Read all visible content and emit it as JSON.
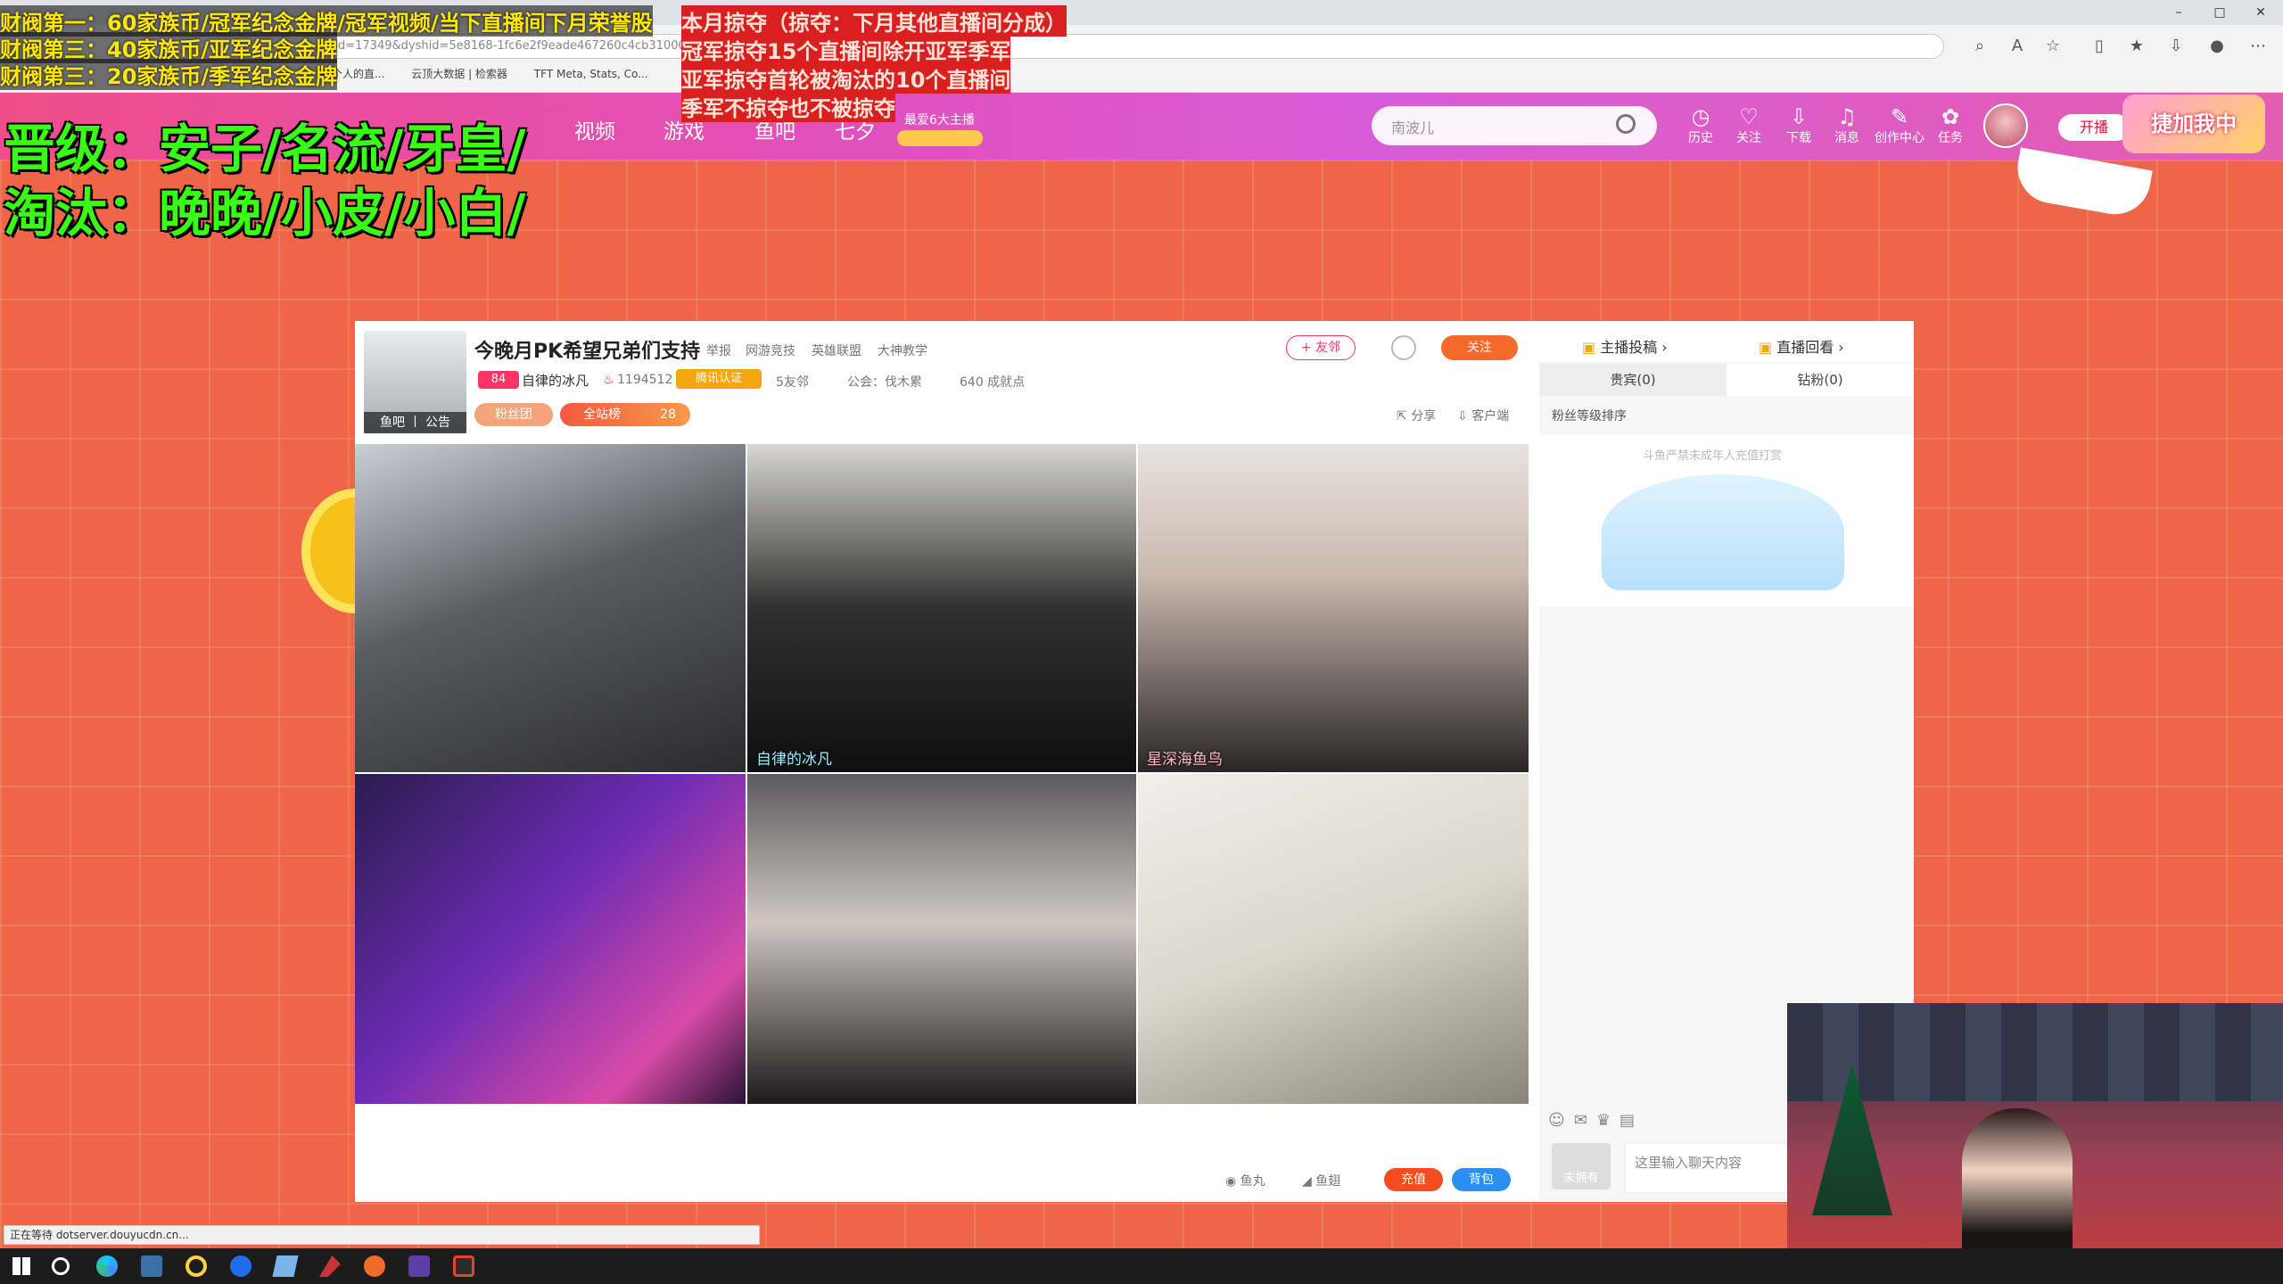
{
  "browser": {
    "url": "d=17349&dyshid=5e8168-1fc6e2f9eade467260c4cb3100021",
    "bookmarks": [
      "每个人的直...",
      "云顶大数据 | 检索器",
      "TFT Meta, Stats, Co..."
    ],
    "status_text": "正在等待 dotserver.douyucdn.cn..."
  },
  "overlay": {
    "yellow_lines": [
      "财阀第一：60家族币/冠军纪念金牌/冠军视频/当下直播间下月荣誉股",
      "财阀第三：40家族币/亚军纪念金牌",
      "财阀第三：20家族币/季军纪念金牌"
    ],
    "red_lines": [
      "本月掠夺（掠夺：下月其他直播间分成）",
      "冠军掠夺15个直播间除开亚军季军",
      "亚军掠夺首轮被淘汰的10个直播间",
      "季军不掠夺也不被掠夺"
    ],
    "promoted": "晋级：安子/名流/牙皇/",
    "eliminated": "淘汰：晚晚/小皮/小白/"
  },
  "site_header": {
    "nav": [
      "视频",
      "游戏",
      "鱼吧",
      "七夕"
    ],
    "promo_label": "最爱6大主播",
    "search_placeholder": "南波儿",
    "icons": [
      {
        "name": "history-icon",
        "glyph": "◷",
        "label": "历史"
      },
      {
        "name": "follow-icon",
        "glyph": "♡",
        "label": "关注"
      },
      {
        "name": "download-icon",
        "glyph": "⇩",
        "label": "下载"
      },
      {
        "name": "message-icon",
        "glyph": "♫",
        "label": "消息"
      },
      {
        "name": "creator-icon",
        "glyph": "✎",
        "label": "创作中心"
      },
      {
        "name": "task-icon",
        "glyph": "✿",
        "label": "任务"
      }
    ],
    "start_stream": "开播",
    "promo_banner": "捷加我中"
  },
  "room": {
    "title": "今晚月PK希望兄弟们支持",
    "report": "举报",
    "breadcrumb": [
      "网游竞技",
      "英雄联盟",
      "大神教学"
    ],
    "level": "84",
    "host_name": "自律的冰凡",
    "heat": "1194512",
    "verified": "腾讯认证",
    "friends": "5友邻",
    "guild": "公会：伐木累",
    "achievements": "640 成就点",
    "avatar_bar": "鱼吧 丨 公告",
    "btn_friend": "+ 友邻",
    "btn_follow": "关注",
    "fanclub": "粉丝团",
    "fullboard": "全站榜",
    "fullboard_rank": "28",
    "share": "分享",
    "client": "客户端",
    "video_labels": [
      "自律的冰凡",
      "星深海鱼鸟"
    ],
    "fish_ball": "鱼丸",
    "fish_wing": "鱼翅",
    "recharge": "充值",
    "backpack": "背包"
  },
  "sidebar": {
    "contribute": "主播投稿",
    "replay": "直播回看",
    "tab_guests": "贵宾(0)",
    "tab_diamond": "钻粉(0)",
    "fan_sort": "粉丝等级排序",
    "notice": "斗鱼严禁未成年人充值打赏",
    "chat_placeholder": "这里输入聊天内容",
    "badge": "未拥有"
  },
  "colors": {
    "accent": "#f56a2b",
    "brand_pink": "#e24fb9",
    "bg": "#ee6548"
  }
}
